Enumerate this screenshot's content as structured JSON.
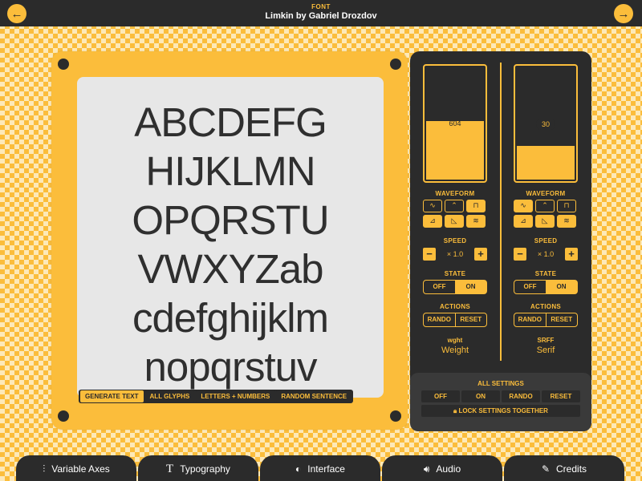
{
  "header": {
    "label": "FONT",
    "font_name": "Limkin by Gabriel Drozdov",
    "prev_icon": "arrow-left-icon",
    "next_icon": "arrow-right-icon"
  },
  "specimen": {
    "lines": [
      "ABCDEFG",
      "HIJKLMN",
      "OPQRSTU",
      "VWXYZab",
      "cdefghijklm",
      "nopqrstuv"
    ]
  },
  "generate_bar": {
    "generate_text": "GENERATE TEXT",
    "all_glyphs": "ALL GLYPHS",
    "letters_numbers": "LETTERS + NUMBERS",
    "random_sentence": "RANDOM SENTENCE"
  },
  "axes": [
    {
      "value": "604",
      "level": 0.52,
      "waveform_label": "WAVEFORM",
      "speed_label": "SPEED",
      "speed_value": "× 1.0",
      "state_label": "STATE",
      "state_off": "OFF",
      "state_on": "ON",
      "actions_label": "ACTIONS",
      "rando": "RANDO",
      "reset": "RESET",
      "tag": "wght",
      "name": "Weight"
    },
    {
      "value": "30",
      "level": 0.3,
      "waveform_label": "WAVEFORM",
      "speed_label": "SPEED",
      "speed_value": "× 1.0",
      "state_label": "STATE",
      "state_off": "OFF",
      "state_on": "ON",
      "actions_label": "ACTIONS",
      "rando": "RANDO",
      "reset": "RESET",
      "tag": "SRFF",
      "name": "Serif"
    }
  ],
  "all_settings": {
    "title": "ALL SETTINGS",
    "off": "OFF",
    "on": "ON",
    "rando": "RANDO",
    "reset": "RESET",
    "lock": "LOCK SETTINGS TOGETHER"
  },
  "tabs": [
    {
      "label": "Variable Axes",
      "icon": "sliders-icon"
    },
    {
      "label": "Typography",
      "icon": "type-icon"
    },
    {
      "label": "Interface",
      "icon": "contrast-icon"
    },
    {
      "label": "Audio",
      "icon": "speaker-icon"
    },
    {
      "label": "Credits",
      "icon": "pen-icon"
    }
  ],
  "colors": {
    "accent": "#fbbd3b",
    "dark": "#2b2b2b",
    "screen": "#e7e7e7"
  }
}
